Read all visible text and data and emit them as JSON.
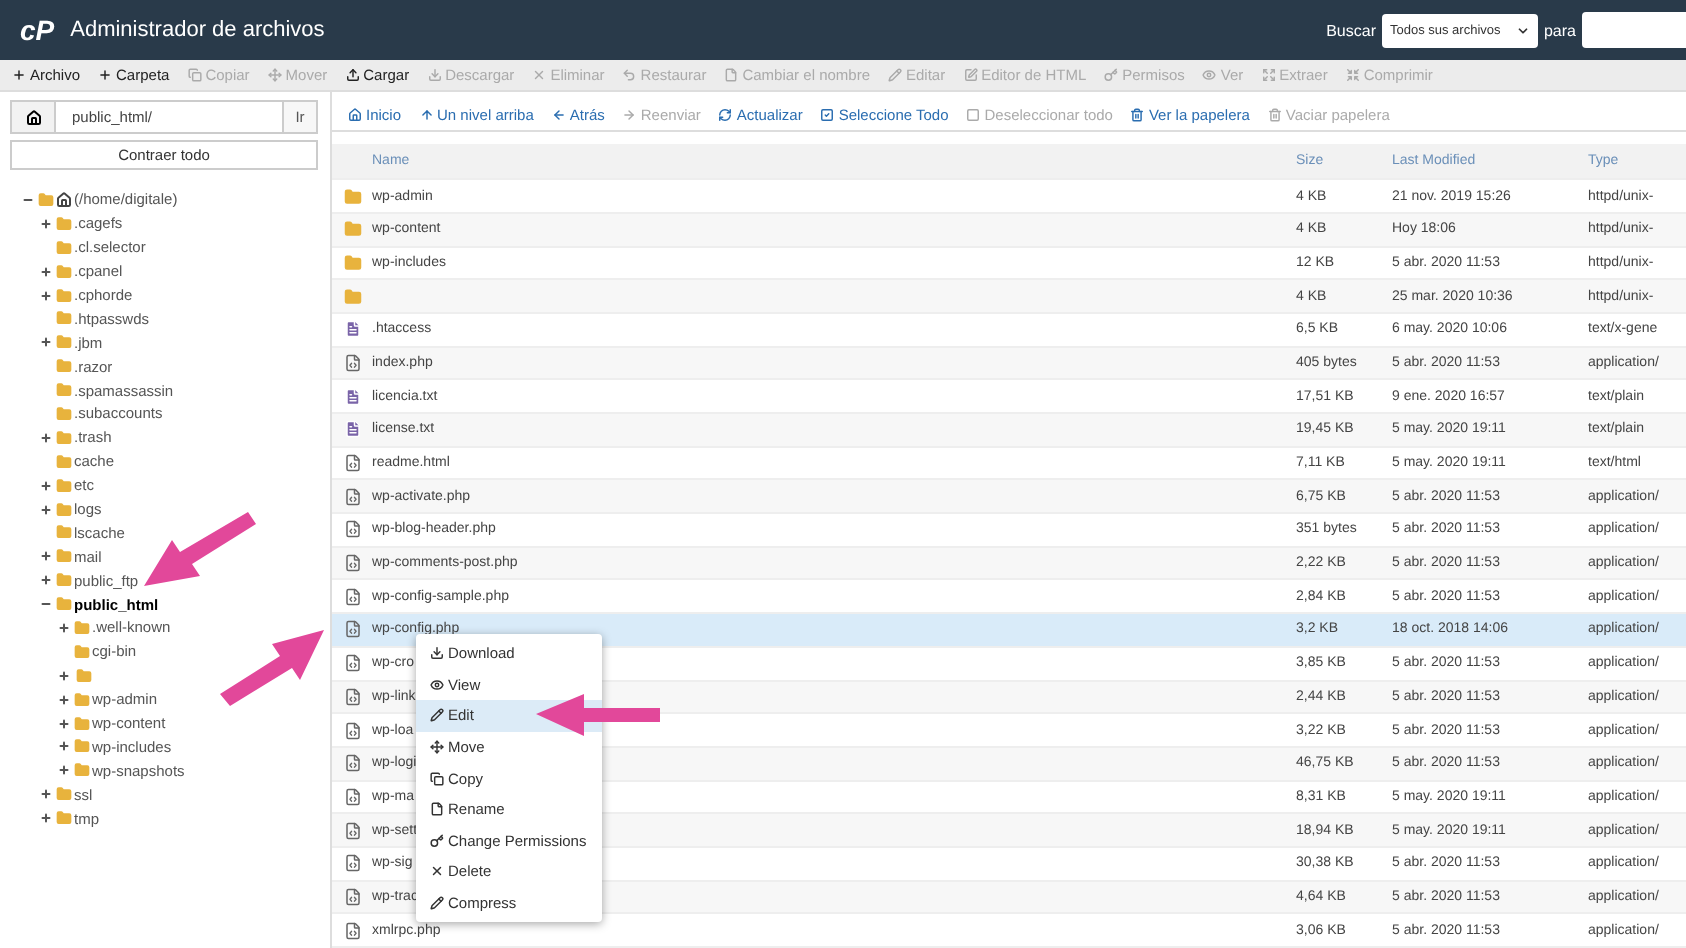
{
  "header": {
    "logo": "cP",
    "title": "Administrador de archivos",
    "search_label": "Buscar",
    "search_scope": "Todos sus archivos",
    "for_label": "para"
  },
  "toolbar": [
    {
      "label": "Archivo",
      "disabled": false
    },
    {
      "label": "Carpeta",
      "disabled": false
    },
    {
      "label": "Copiar",
      "disabled": true
    },
    {
      "label": "Mover",
      "disabled": true
    },
    {
      "label": "Cargar",
      "disabled": false
    },
    {
      "label": "Descargar",
      "disabled": true
    },
    {
      "label": "Eliminar",
      "disabled": true
    },
    {
      "label": "Restaurar",
      "disabled": true
    },
    {
      "label": "Cambiar el nombre",
      "disabled": true
    },
    {
      "label": "Editar",
      "disabled": true
    },
    {
      "label": "Editor de HTML",
      "disabled": true
    },
    {
      "label": "Permisos",
      "disabled": true
    },
    {
      "label": "Ver",
      "disabled": true
    },
    {
      "label": "Extraer",
      "disabled": true
    },
    {
      "label": "Comprimir",
      "disabled": true
    }
  ],
  "path_bar": {
    "value": "public_html/",
    "go": "Ir"
  },
  "collapse_all": "Contraer todo",
  "tree": [
    {
      "name": "(/home/digitale)",
      "home": true,
      "expandable": true,
      "expanded": true,
      "selected": false,
      "children": [
        {
          "name": ".cagefs",
          "expandable": true,
          "expanded": false,
          "selected": false
        },
        {
          "name": ".cl.selector",
          "expandable": false,
          "selected": false
        },
        {
          "name": ".cpanel",
          "expandable": true,
          "expanded": false,
          "selected": false
        },
        {
          "name": ".cphorde",
          "expandable": true,
          "expanded": false,
          "selected": false
        },
        {
          "name": ".htpasswds",
          "expandable": false,
          "selected": false
        },
        {
          "name": ".jbm",
          "expandable": true,
          "expanded": false,
          "selected": false
        },
        {
          "name": ".razor",
          "expandable": false,
          "selected": false
        },
        {
          "name": ".spamassassin",
          "expandable": false,
          "selected": false
        },
        {
          "name": ".subaccounts",
          "expandable": false,
          "selected": false
        },
        {
          "name": ".trash",
          "expandable": true,
          "expanded": false,
          "selected": false
        },
        {
          "name": "cache",
          "expandable": false,
          "selected": false
        },
        {
          "name": "etc",
          "expandable": true,
          "expanded": false,
          "selected": false
        },
        {
          "name": "logs",
          "expandable": true,
          "expanded": false,
          "selected": false
        },
        {
          "name": "lscache",
          "expandable": false,
          "selected": false
        },
        {
          "name": "mail",
          "expandable": true,
          "expanded": false,
          "selected": false
        },
        {
          "name": "public_ftp",
          "expandable": true,
          "expanded": false,
          "selected": false
        },
        {
          "name": "public_html",
          "expandable": true,
          "expanded": true,
          "selected": true,
          "children": [
            {
              "name": ".well-known",
              "expandable": true,
              "expanded": false,
              "selected": false
            },
            {
              "name": "cgi-bin",
              "expandable": false,
              "selected": false
            },
            {
              "expandable": true,
              "expanded": false,
              "selected": false
            },
            {
              "name": "wp-admin",
              "expandable": true,
              "expanded": false,
              "selected": false
            },
            {
              "name": "wp-content",
              "expandable": true,
              "expanded": false,
              "selected": false
            },
            {
              "name": "wp-includes",
              "expandable": true,
              "expanded": false,
              "selected": false
            },
            {
              "name": "wp-snapshots",
              "expandable": true,
              "expanded": false,
              "selected": false
            }
          ]
        },
        {
          "name": "ssl",
          "expandable": true,
          "expanded": false,
          "selected": false
        },
        {
          "name": "tmp",
          "expandable": true,
          "expanded": false,
          "selected": false
        }
      ]
    }
  ],
  "nav": [
    {
      "label": "Inicio",
      "disabled": false
    },
    {
      "label": "Un nivel arriba",
      "disabled": false
    },
    {
      "label": "Atrás",
      "disabled": false
    },
    {
      "label": "Reenviar",
      "disabled": true
    },
    {
      "label": "Actualizar",
      "disabled": false
    },
    {
      "label": "Seleccione Todo",
      "disabled": false
    },
    {
      "label": "Deseleccionar todo",
      "disabled": true
    },
    {
      "label": "Ver la papelera",
      "disabled": false
    },
    {
      "label": "Vaciar papelera",
      "disabled": true
    }
  ],
  "table": {
    "columns": [
      "Name",
      "Size",
      "Last Modified",
      "Type"
    ],
    "rows": [
      {
        "kind": "folder",
        "name": "wp-admin",
        "size": "4 KB",
        "modified": "21 nov. 2019 15:26",
        "type": "httpd/unix-",
        "selected": false
      },
      {
        "kind": "folder",
        "name": "wp-content",
        "size": "4 KB",
        "modified": "Hoy 18:06",
        "type": "httpd/unix-",
        "selected": false
      },
      {
        "kind": "folder",
        "name": "wp-includes",
        "size": "12 KB",
        "modified": "5 abr. 2020 11:53",
        "type": "httpd/unix-",
        "selected": false
      },
      {
        "kind": "folder",
        "size": "4 KB",
        "modified": "25 mar. 2020 10:36",
        "type": "httpd/unix-",
        "selected": false
      },
      {
        "kind": "text",
        "name": ".htaccess",
        "size": "6,5 KB",
        "modified": "6 may. 2020 10:06",
        "type": "text/x-gene",
        "selected": false
      },
      {
        "kind": "code",
        "name": "index.php",
        "size": "405 bytes",
        "modified": "5 abr. 2020 11:53",
        "type": "application/",
        "selected": false
      },
      {
        "kind": "text",
        "name": "licencia.txt",
        "size": "17,51 KB",
        "modified": "9 ene. 2020 16:57",
        "type": "text/plain",
        "selected": false
      },
      {
        "kind": "text",
        "name": "license.txt",
        "size": "19,45 KB",
        "modified": "5 may. 2020 19:11",
        "type": "text/plain",
        "selected": false
      },
      {
        "kind": "code",
        "name": "readme.html",
        "size": "7,11 KB",
        "modified": "5 may. 2020 19:11",
        "type": "text/html",
        "selected": false
      },
      {
        "kind": "code",
        "name": "wp-activate.php",
        "size": "6,75 KB",
        "modified": "5 abr. 2020 11:53",
        "type": "application/",
        "selected": false
      },
      {
        "kind": "code",
        "name": "wp-blog-header.php",
        "size": "351 bytes",
        "modified": "5 abr. 2020 11:53",
        "type": "application/",
        "selected": false
      },
      {
        "kind": "code",
        "name": "wp-comments-post.php",
        "size": "2,22 KB",
        "modified": "5 abr. 2020 11:53",
        "type": "application/",
        "selected": false
      },
      {
        "kind": "code",
        "name": "wp-config-sample.php",
        "size": "2,84 KB",
        "modified": "5 abr. 2020 11:53",
        "type": "application/",
        "selected": false
      },
      {
        "kind": "code",
        "name": "wp-config.php",
        "size": "3,2 KB",
        "modified": "18 oct. 2018 14:06",
        "type": "application/",
        "selected": true
      },
      {
        "kind": "code",
        "name": "wp-cro",
        "size": "3,85 KB",
        "modified": "5 abr. 2020 11:53",
        "type": "application/",
        "selected": false
      },
      {
        "kind": "code",
        "name": "wp-link",
        "size": "2,44 KB",
        "modified": "5 abr. 2020 11:53",
        "type": "application/",
        "selected": false
      },
      {
        "kind": "code",
        "name": "wp-loa",
        "size": "3,22 KB",
        "modified": "5 abr. 2020 11:53",
        "type": "application/",
        "selected": false
      },
      {
        "kind": "code",
        "name": "wp-logi",
        "size": "46,75 KB",
        "modified": "5 abr. 2020 11:53",
        "type": "application/",
        "selected": false
      },
      {
        "kind": "code",
        "name": "wp-ma",
        "size": "8,31 KB",
        "modified": "5 may. 2020 19:11",
        "type": "application/",
        "selected": false
      },
      {
        "kind": "code",
        "name": "wp-sett",
        "size": "18,94 KB",
        "modified": "5 may. 2020 19:11",
        "type": "application/",
        "selected": false
      },
      {
        "kind": "code",
        "name": "wp-sig",
        "size": "30,38 KB",
        "modified": "5 abr. 2020 11:53",
        "type": "application/",
        "selected": false
      },
      {
        "kind": "code",
        "name": "wp-trac",
        "size": "4,64 KB",
        "modified": "5 abr. 2020 11:53",
        "type": "application/",
        "selected": false
      },
      {
        "kind": "code",
        "name": "xmlrpc.php",
        "size": "3,06 KB",
        "modified": "5 abr. 2020 11:53",
        "type": "application/",
        "selected": false
      }
    ]
  },
  "context_menu": [
    {
      "label": "Download",
      "selected": false
    },
    {
      "label": "View",
      "selected": false
    },
    {
      "label": "Edit",
      "selected": true
    },
    {
      "label": "Move",
      "selected": false
    },
    {
      "label": "Copy",
      "selected": false
    },
    {
      "label": "Rename",
      "selected": false
    },
    {
      "label": "Change Permissions",
      "selected": false
    },
    {
      "label": "Delete",
      "selected": false
    },
    {
      "label": "Compress",
      "selected": false
    }
  ]
}
